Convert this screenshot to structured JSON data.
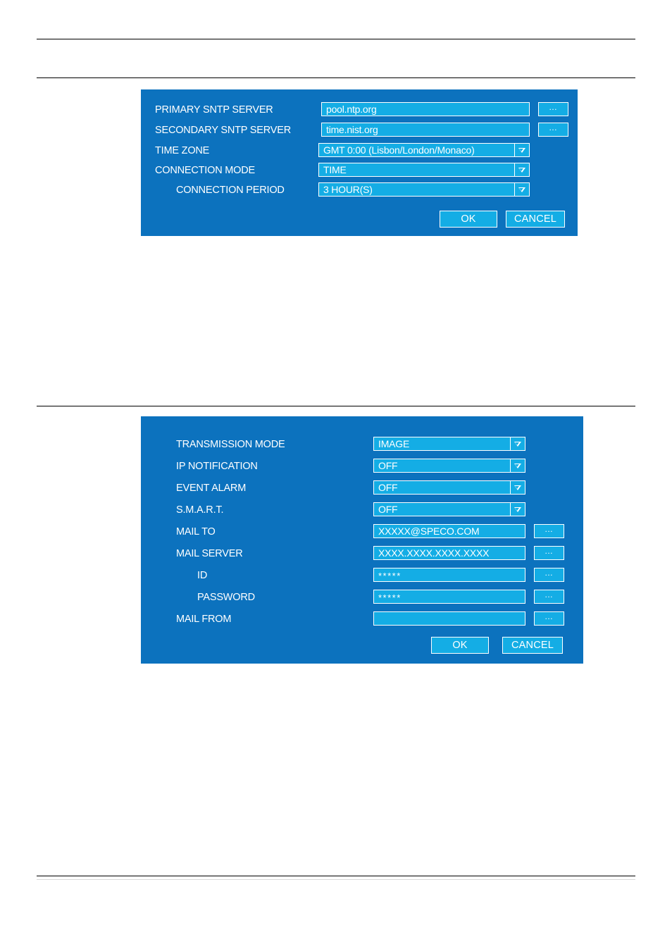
{
  "page": {
    "background": "#ffffff",
    "rule_color": "#000000"
  },
  "theme": {
    "dialog_bg": "#0c72be",
    "field_bg": "#14ade5",
    "border": "#ffffff",
    "text": "#ffffff"
  },
  "dialog_sntp": {
    "rows": [
      {
        "label": "PRIMARY SNTP SERVER",
        "value": "pool.ntp.org",
        "control": "text",
        "browse": "…"
      },
      {
        "label": "SECONDARY  SNTP SERVER",
        "value": "time.nist.org",
        "control": "text",
        "browse": "…"
      },
      {
        "label": "TIME ZONE",
        "value": "GMT 0:00 (Lisbon/London/Monaco)",
        "control": "select"
      },
      {
        "label": "CONNECTION MODE",
        "value": "TIME",
        "control": "select"
      },
      {
        "label": "CONNECTION PERIOD",
        "value": "3 HOUR(S)",
        "control": "select",
        "indent": true
      }
    ],
    "ok_label": "OK",
    "cancel_label": "CANCEL"
  },
  "dialog_mail": {
    "rows": [
      {
        "label": "TRANSMISSION MODE",
        "value": "IMAGE",
        "control": "select"
      },
      {
        "label": "IP NOTIFICATION",
        "value": "OFF",
        "control": "select"
      },
      {
        "label": "EVENT ALARM",
        "value": "OFF",
        "control": "select"
      },
      {
        "label": "S.M.A.R.T.",
        "value": "OFF",
        "control": "select"
      },
      {
        "label": "MAIL TO",
        "value": "XXXXX@SPECO.COM",
        "control": "text",
        "browse": "…"
      },
      {
        "label": "MAIL SERVER",
        "value": "XXXX.XXXX.XXXX.XXXX",
        "control": "text",
        "browse": "…"
      },
      {
        "label": "ID",
        "value": "*****",
        "control": "text",
        "browse": "…",
        "indent": true,
        "masked": true
      },
      {
        "label": "PASSWORD",
        "value": "*****",
        "control": "text",
        "browse": "…",
        "indent": true,
        "masked": true
      },
      {
        "label": "MAIL FROM",
        "value": "",
        "control": "text",
        "browse": "…"
      }
    ],
    "ok_label": "OK",
    "cancel_label": "CANCEL"
  }
}
